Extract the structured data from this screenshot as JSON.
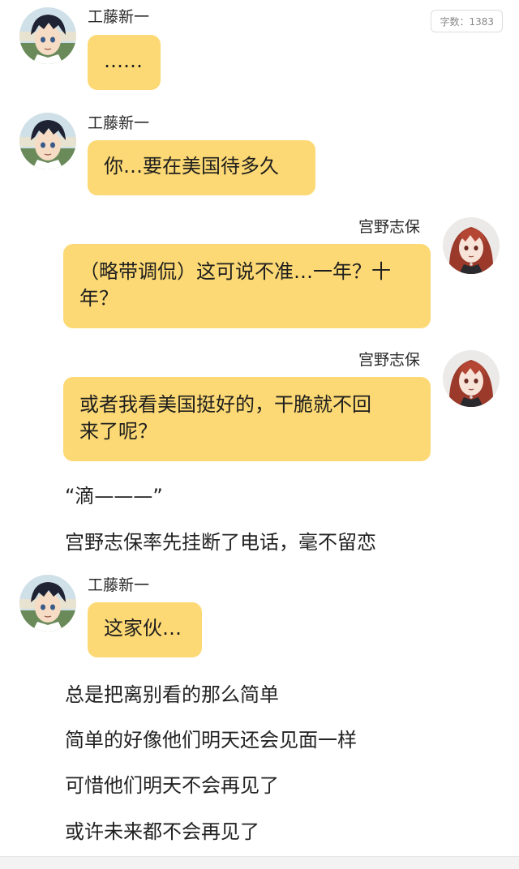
{
  "word_count": "字数：1383",
  "messages": [
    {
      "speaker": "工藤新一",
      "side": "left",
      "text": "……"
    },
    {
      "speaker": "工藤新一",
      "side": "left",
      "text": "你…要在美国待多久"
    },
    {
      "speaker": "宫野志保",
      "side": "right",
      "line1": "（略带调侃）这可说不准…一年？十",
      "line2": "年？"
    },
    {
      "speaker": "宫野志保",
      "side": "right",
      "line1": "或者我看美国挺好的，干脆就不回",
      "line2": "来了呢？"
    },
    {
      "speaker": "工藤新一",
      "side": "left",
      "text": "这家伙…"
    }
  ],
  "narration": [
    "“滴———”",
    "宫野志保率先挂断了电话，毫不留恋",
    "总是把离别看的那么简单",
    "简单的好像他们明天还会见面一样",
    "可惜他们明天不会再见了",
    "或许未来都不会再见了"
  ]
}
